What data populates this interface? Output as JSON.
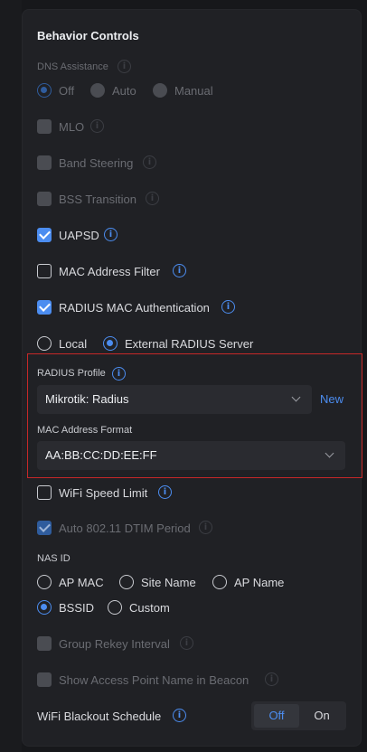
{
  "section_title": "Behavior Controls",
  "dns": {
    "label": "DNS Assistance",
    "options": [
      "Off",
      "Auto",
      "Manual"
    ],
    "selected": "Off"
  },
  "mlo": {
    "label": "MLO",
    "checked": false,
    "disabled": true
  },
  "band_steering": {
    "label": "Band Steering",
    "checked": false,
    "disabled": true
  },
  "bss_transition": {
    "label": "BSS Transition",
    "checked": false,
    "disabled": true
  },
  "uapsd": {
    "label": "UAPSD",
    "checked": true
  },
  "mac_filter": {
    "label": "MAC Address Filter",
    "checked": false
  },
  "radius_mac_auth": {
    "label": "RADIUS MAC Authentication",
    "checked": true
  },
  "auth_source": {
    "options": [
      "Local",
      "External RADIUS Server"
    ],
    "selected": "External RADIUS Server"
  },
  "radius_profile": {
    "label": "RADIUS Profile",
    "value": "Mikrotik: Radius",
    "new_label": "New"
  },
  "mac_format": {
    "label": "MAC Address Format",
    "value": "AA:BB:CC:DD:EE:FF"
  },
  "wifi_speed_limit": {
    "label": "WiFi Speed Limit",
    "checked": false
  },
  "dtim": {
    "label": "Auto 802.11 DTIM Period",
    "checked": true,
    "disabled": true
  },
  "nas_id": {
    "label": "NAS ID",
    "options": [
      "AP MAC",
      "Site Name",
      "AP Name",
      "BSSID",
      "Custom"
    ],
    "selected": "BSSID"
  },
  "group_rekey": {
    "label": "Group Rekey Interval",
    "checked": false,
    "disabled": true
  },
  "show_ap_name": {
    "label": "Show Access Point Name in Beacon",
    "checked": false,
    "disabled": true
  },
  "blackout": {
    "label": "WiFi Blackout Schedule",
    "off_label": "Off",
    "on_label": "On",
    "selected": "Off"
  },
  "colors": {
    "accent": "#4c8df0",
    "highlight_border": "#c62828",
    "panel_bg": "#202125"
  }
}
